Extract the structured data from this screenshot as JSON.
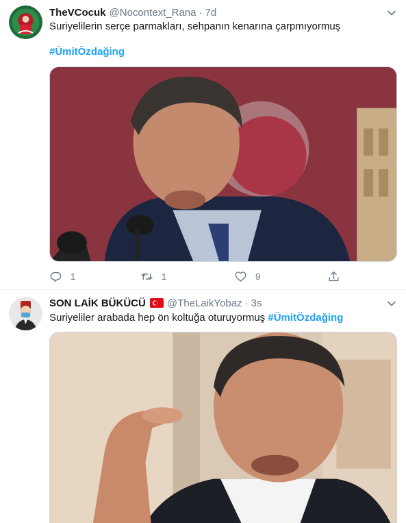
{
  "tweets": [
    {
      "display_name": "TheVCocuk",
      "handle": "@Nocontext_Rana",
      "separator": "·",
      "time": "7d",
      "text": "Suriyelilerin serçe parmakları, sehpanın kenarına çarpmıyormuş",
      "hashtag": "#ÜmitÖzdağing",
      "actions": {
        "replies": "1",
        "retweets": "1",
        "likes": "9"
      }
    },
    {
      "display_name": "SON LAİK BÜKÜCÜ",
      "handle": "@TheLaikYobaz",
      "separator": "·",
      "time": "3s",
      "text": "Suriyeliler arabada hep ön koltuğa oturuyormuş",
      "hashtag": "#ÜmitÖzdağing"
    }
  ],
  "icons": {
    "reply": "reply-icon",
    "retweet": "retweet-icon",
    "like": "heart-icon",
    "share": "share-icon",
    "more": "chevron-down-icon",
    "flag": "turkey-flag-icon"
  },
  "colors": {
    "link": "#1da1f2",
    "secondary_text": "#657786",
    "divider": "#e6ecf0"
  }
}
